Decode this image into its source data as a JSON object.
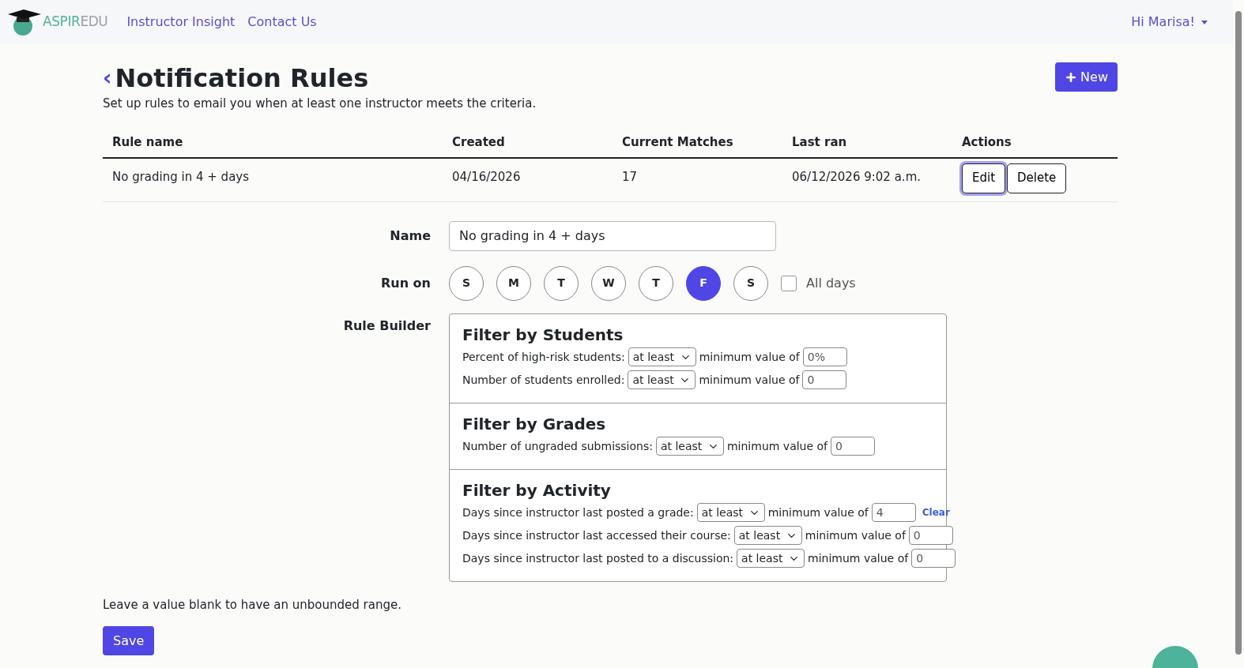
{
  "navbar": {
    "logo": {
      "part1": "ASPIR",
      "part2": "EDU"
    },
    "links": [
      "Instructor Insight",
      "Contact Us"
    ],
    "user_menu": "Hi Marisa!"
  },
  "header": {
    "back": "‹",
    "title": "Notification Rules",
    "subtitle": "Set up rules to email you when at least one instructor meets the criteria.",
    "new_button": "New"
  },
  "table": {
    "columns": [
      "Rule name",
      "Created",
      "Current Matches",
      "Last ran",
      "Actions"
    ],
    "rows": [
      {
        "cells": [
          "No grading in 4 + days",
          "04/16/2026",
          "17",
          "06/12/2026 9:02 a.m."
        ],
        "actions": [
          {
            "label": "Edit",
            "focused": true
          },
          {
            "label": "Delete",
            "focused": false
          }
        ]
      }
    ]
  },
  "form": {
    "name_label": "Name",
    "name_value": "No grading in 4 + days",
    "run_on_label": "Run on",
    "days": [
      {
        "label": "S",
        "selected": false
      },
      {
        "label": "M",
        "selected": false
      },
      {
        "label": "T",
        "selected": false
      },
      {
        "label": "W",
        "selected": false
      },
      {
        "label": "T",
        "selected": false
      },
      {
        "label": "F",
        "selected": true
      },
      {
        "label": "S",
        "selected": false
      }
    ],
    "all_days": {
      "label": "All days",
      "checked": false
    },
    "rule_builder_label": "Rule Builder",
    "sections": [
      {
        "title": "Filter by Students",
        "rows": [
          {
            "label": "Percent of high-risk students:",
            "operator": "at least",
            "min_label": "minimum value of",
            "value": "0%"
          },
          {
            "label": "Number of students enrolled:",
            "operator": "at least",
            "min_label": "minimum value of",
            "value": "0"
          }
        ]
      },
      {
        "title": "Filter by Grades",
        "rows": [
          {
            "label": "Number of ungraded submissions:",
            "operator": "at least",
            "min_label": "minimum value of",
            "value": "0"
          }
        ]
      },
      {
        "title": "Filter by Activity",
        "rows": [
          {
            "label": "Days since instructor last posted a grade:",
            "operator": "at least",
            "min_label": "minimum value of",
            "value": "4",
            "clear": "Clear"
          },
          {
            "label": "Days since instructor last accessed their course:",
            "operator": "at least",
            "min_label": "minimum value of",
            "value": "0"
          },
          {
            "label": "Days since instructor last posted to a discussion:",
            "operator": "at least",
            "min_label": "minimum value of",
            "value": "0"
          }
        ]
      }
    ]
  },
  "footer": {
    "hint": "Leave a value blank to have an unbounded range.",
    "save": "Save"
  }
}
